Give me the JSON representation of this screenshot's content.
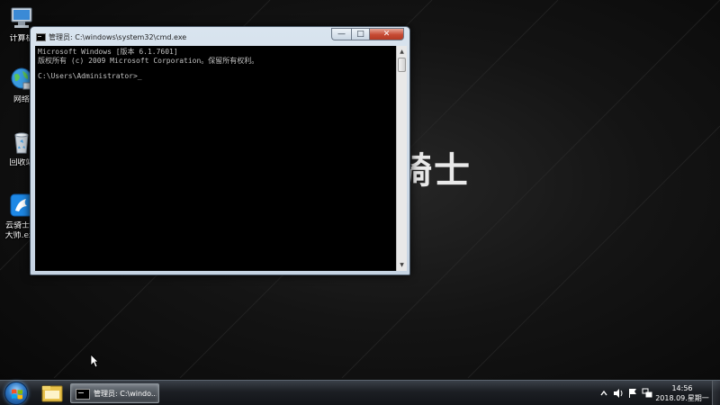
{
  "desktop": {
    "icons": [
      {
        "name": "computer",
        "label": "计算机",
        "label2": ""
      },
      {
        "name": "network",
        "label": "网络",
        "label2": ""
      },
      {
        "name": "recycle-bin",
        "label": "回收站",
        "label2": ""
      },
      {
        "name": "yunqishi",
        "label": "云骑士装",
        "label2": "大师.exe"
      }
    ],
    "wallpaper_text": "骑士"
  },
  "cmd_window": {
    "title": "管理员: C:\\windows\\system32\\cmd.exe",
    "buttons": {
      "minimize": "—",
      "maximize": "□",
      "close": "✕"
    },
    "console_lines": [
      "Microsoft Windows [版本 6.1.7601]",
      "版权所有 (c) 2009 Microsoft Corporation。保留所有权利。"
    ],
    "prompt": "C:\\Users\\Administrator>",
    "cursor": "_"
  },
  "taskbar": {
    "active_task_label": "管理员: C:\\windo...",
    "clock_time": "14:56",
    "clock_date": "2018.09.星期一"
  },
  "colors": {
    "console_bg": "#000000",
    "console_text": "#c0c0c0",
    "close_button": "#c64a33",
    "titlebar": "#d9e4ef"
  }
}
